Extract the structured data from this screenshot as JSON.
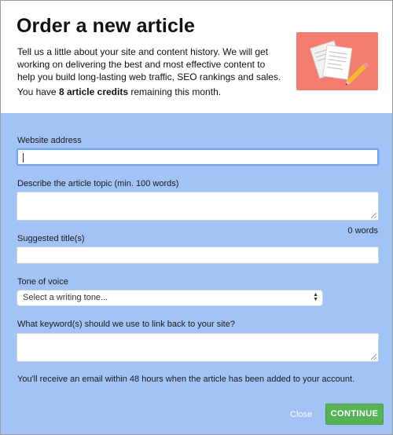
{
  "header": {
    "title": "Order a new article",
    "intro": "Tell us a little about your site and content history. We will get working on delivering the best and most effective content to help you build long-lasting web traffic, SEO rankings and sales.",
    "credits_prefix": "You have ",
    "credits_bold": "8 article credits",
    "credits_suffix": " remaining this month.",
    "illustration_icon": "documents-and-pencil-illustration",
    "illustration_bg": "#f47d6f"
  },
  "form": {
    "background": "#a2c3f5",
    "website": {
      "label": "Website address",
      "value": ""
    },
    "topic": {
      "label": "Describe the article topic (min. 100 words)",
      "value": "",
      "word_count": "0 words"
    },
    "titles": {
      "label": "Suggested title(s)",
      "value": ""
    },
    "tone": {
      "label": "Tone of voice",
      "selected": "Select a writing tone..."
    },
    "keywords": {
      "label": "What keyword(s) should we use to link back to your site?",
      "value": ""
    },
    "notice": "You'll receive an email within 48 hours when the article has been added to your account."
  },
  "actions": {
    "close_label": "Close",
    "continue_label": "CONTINUE",
    "continue_color": "#57b255"
  }
}
